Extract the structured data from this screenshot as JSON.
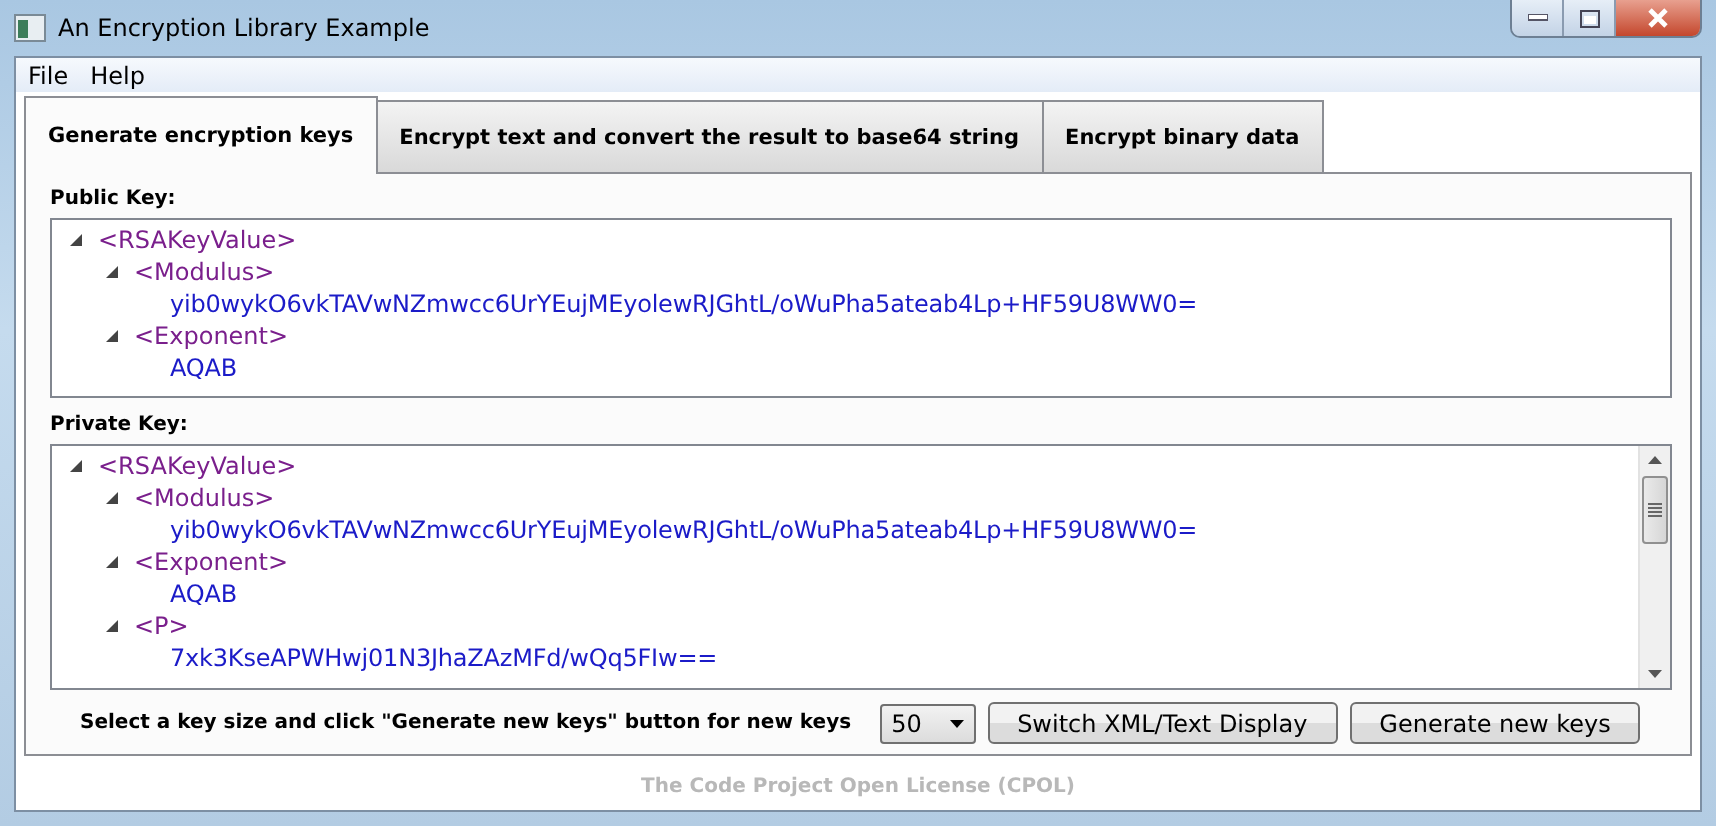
{
  "window": {
    "title": "An Encryption Library Example"
  },
  "menu": [
    "File",
    "Help"
  ],
  "tabs": [
    {
      "label": "Generate encryption keys",
      "selected": true
    },
    {
      "label": "Encrypt text and convert the result to base64 string",
      "selected": false
    },
    {
      "label": "Encrypt binary data",
      "selected": false
    }
  ],
  "public_key": {
    "label": "Public Key:",
    "tree": [
      {
        "tag": "<RSAKeyValue>",
        "expanded": true,
        "children": [
          {
            "tag": "<Modulus>",
            "expanded": true,
            "children": [
              {
                "text": "yib0wykO6vkTAVwNZmwcc6UrYEujMEyolewRJGhtL/oWuPha5ateab4Lp+HF59U8WW0="
              }
            ]
          },
          {
            "tag": "<Exponent>",
            "expanded": true,
            "children": [
              {
                "text": "AQAB"
              }
            ]
          }
        ]
      }
    ]
  },
  "private_key": {
    "label": "Private Key:",
    "tree": [
      {
        "tag": "<RSAKeyValue>",
        "expanded": true,
        "children": [
          {
            "tag": "<Modulus>",
            "expanded": true,
            "children": [
              {
                "text": "yib0wykO6vkTAVwNZmwcc6UrYEujMEyolewRJGhtL/oWuPha5ateab4Lp+HF59U8WW0="
              }
            ]
          },
          {
            "tag": "<Exponent>",
            "expanded": true,
            "children": [
              {
                "text": "AQAB"
              }
            ]
          },
          {
            "tag": "<P>",
            "expanded": true,
            "children": [
              {
                "text": "7xk3KseAPWHwj01N3JhaZAzMFd/wQq5FIw=="
              }
            ]
          }
        ]
      }
    ]
  },
  "footer": {
    "instruction": "Select a key size and click \"Generate new keys\" button for new keys",
    "key_size": "50",
    "buttons": [
      "Switch XML/Text Display",
      "Generate new keys"
    ]
  },
  "license": "The Code Project Open License (CPOL)"
}
